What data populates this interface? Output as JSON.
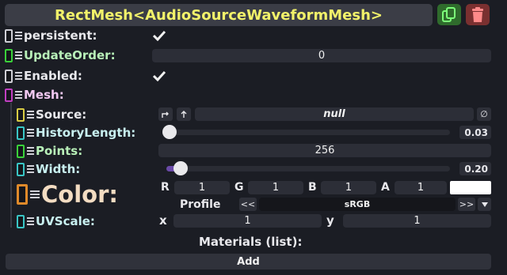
{
  "header": {
    "title": "RectMesh<AudioSourceWaveformMesh>"
  },
  "fields": {
    "persistent": {
      "label": "persistent:",
      "checked": true
    },
    "update_order": {
      "label": "UpdateOrder:",
      "value": "0"
    },
    "enabled": {
      "label": "Enabled:",
      "checked": true
    },
    "mesh": {
      "label": "Mesh:"
    },
    "source": {
      "label": "Source:",
      "value": "null",
      "clear_glyph": "∅"
    },
    "history_length": {
      "label": "HistoryLength:",
      "value": "0.03",
      "fraction": 0.03
    },
    "points": {
      "label": "Points:",
      "value": "256"
    },
    "width": {
      "label": "Width:",
      "value": "0.20",
      "fraction": 0.05
    },
    "color": {
      "label": "Color:",
      "r_label": "R",
      "r": "1",
      "g_label": "G",
      "g": "1",
      "b_label": "B",
      "b": "1",
      "a_label": "A",
      "a": "1",
      "swatch": "#ffffff",
      "profile_label": "Profile",
      "profile_prev": "<<",
      "profile_value": "sRGB",
      "profile_next": ">>"
    },
    "uv_scale": {
      "label": "UVScale:",
      "x_label": "x",
      "x": "1",
      "y_label": "y",
      "y": "1"
    }
  },
  "materials": {
    "label": "Materials (list):"
  },
  "add_button": {
    "label": "Add"
  },
  "colors": {
    "title": "#f2f26a",
    "slot_white": "#cfcfd6",
    "slot_green": "#3ad13a",
    "slot_purple": "#c13fc1",
    "slot_yellow": "#d9cc44",
    "slot_cyan": "#39c6c6",
    "slot_orange": "#e08a2a"
  },
  "icons": [
    "duplicate-icon",
    "trash-icon",
    "checkmark-icon",
    "drag-handle-icon",
    "link-icon",
    "jump-up-icon",
    "dropdown-arrow-icon"
  ]
}
